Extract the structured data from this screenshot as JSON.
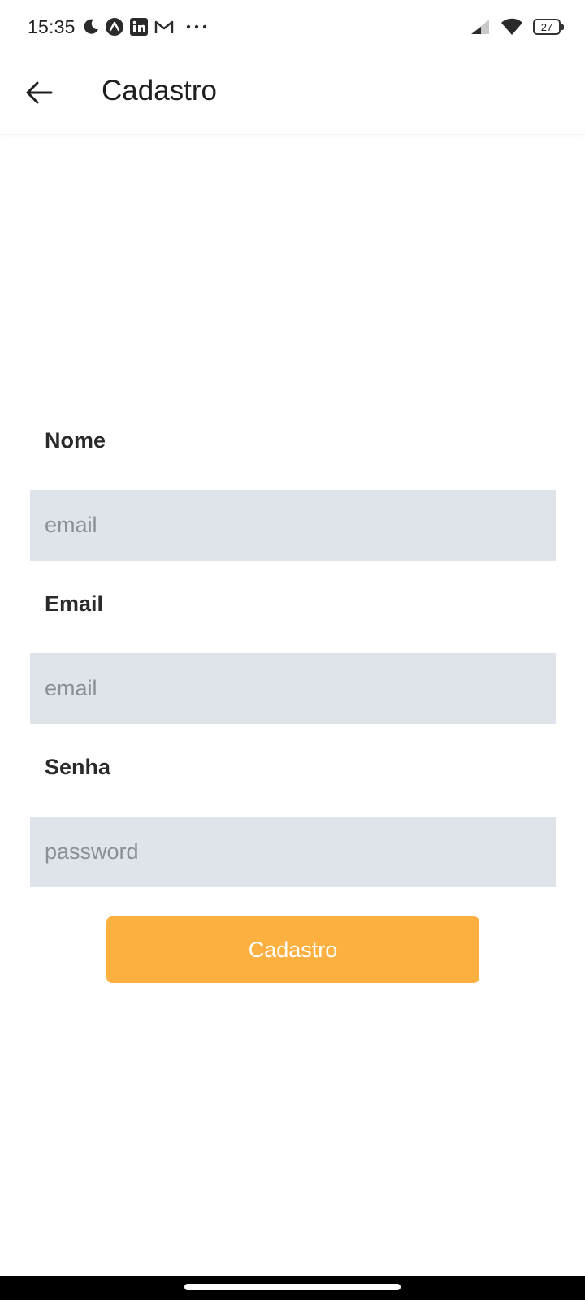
{
  "status_bar": {
    "time": "15:35",
    "notification_icons": [
      "moon-icon",
      "app-a-icon",
      "linkedin-icon",
      "gmail-icon",
      "more-dots-icon"
    ],
    "battery_level": "27"
  },
  "app_bar": {
    "back_icon": "arrow-left-icon",
    "title": "Cadastro"
  },
  "form": {
    "name": {
      "label": "Nome",
      "placeholder": "email",
      "value": ""
    },
    "email": {
      "label": "Email",
      "placeholder": "email",
      "value": ""
    },
    "password": {
      "label": "Senha",
      "placeholder": "password",
      "value": ""
    },
    "submit_label": "Cadastro"
  },
  "colors": {
    "accent": "#fcb040",
    "input_background": "#dfe3ea",
    "placeholder": "#8b8f95"
  }
}
